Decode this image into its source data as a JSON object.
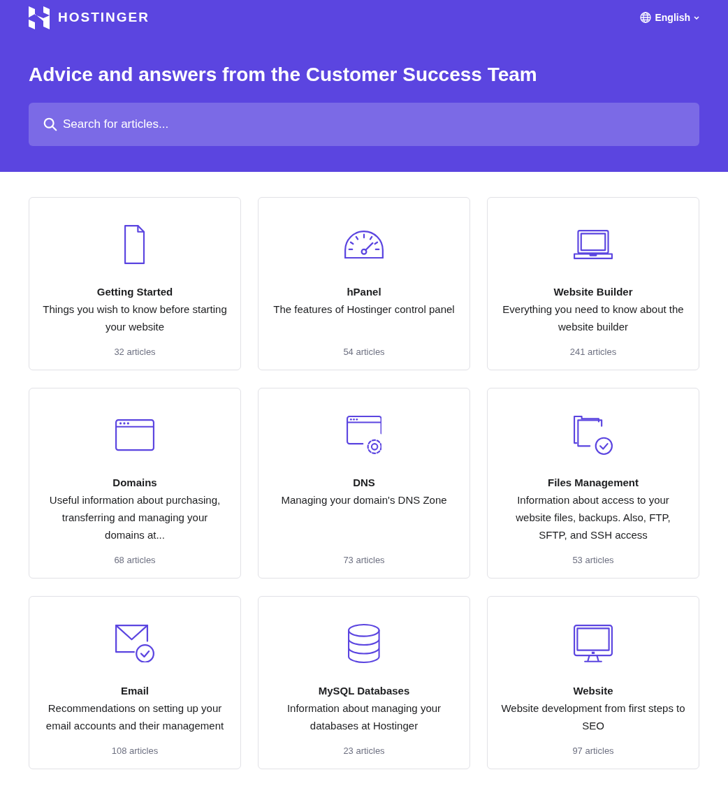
{
  "header": {
    "brand": "HOSTINGER",
    "language": "English",
    "title": "Advice and answers from the Customer Success Team",
    "search": {
      "placeholder": "Search for articles..."
    }
  },
  "collections": [
    {
      "kind": "document",
      "title": "Getting Started",
      "description": "Things you wish to know before starting your website",
      "count": "32 articles"
    },
    {
      "kind": "gauge",
      "title": "hPanel",
      "description": "The features of Hostinger control panel",
      "count": "54 articles"
    },
    {
      "kind": "laptop",
      "title": "Website Builder",
      "description": "Everything you need to know about the website builder",
      "count": "241 articles"
    },
    {
      "kind": "browser",
      "title": "Domains",
      "description": "Useful information about purchasing, transferring and managing your domains at...",
      "count": "68 articles"
    },
    {
      "kind": "browser-gear",
      "title": "DNS",
      "description": "Managing your domain's DNS Zone",
      "count": "73 articles"
    },
    {
      "kind": "folder-check",
      "title": "Files Management",
      "description": "Information about access to your website files, backups. Also, FTP, SFTP, and SSH access",
      "count": "53 articles"
    },
    {
      "kind": "mail-check",
      "title": "Email",
      "description": "Recommendations on setting up your email accounts and their management",
      "count": "108 articles"
    },
    {
      "kind": "database",
      "title": "MySQL Databases",
      "description": "Information about managing your databases at Hostinger",
      "count": "23 articles"
    },
    {
      "kind": "monitor",
      "title": "Website",
      "description": "Website development from first steps to SEO",
      "count": "97 articles"
    }
  ]
}
